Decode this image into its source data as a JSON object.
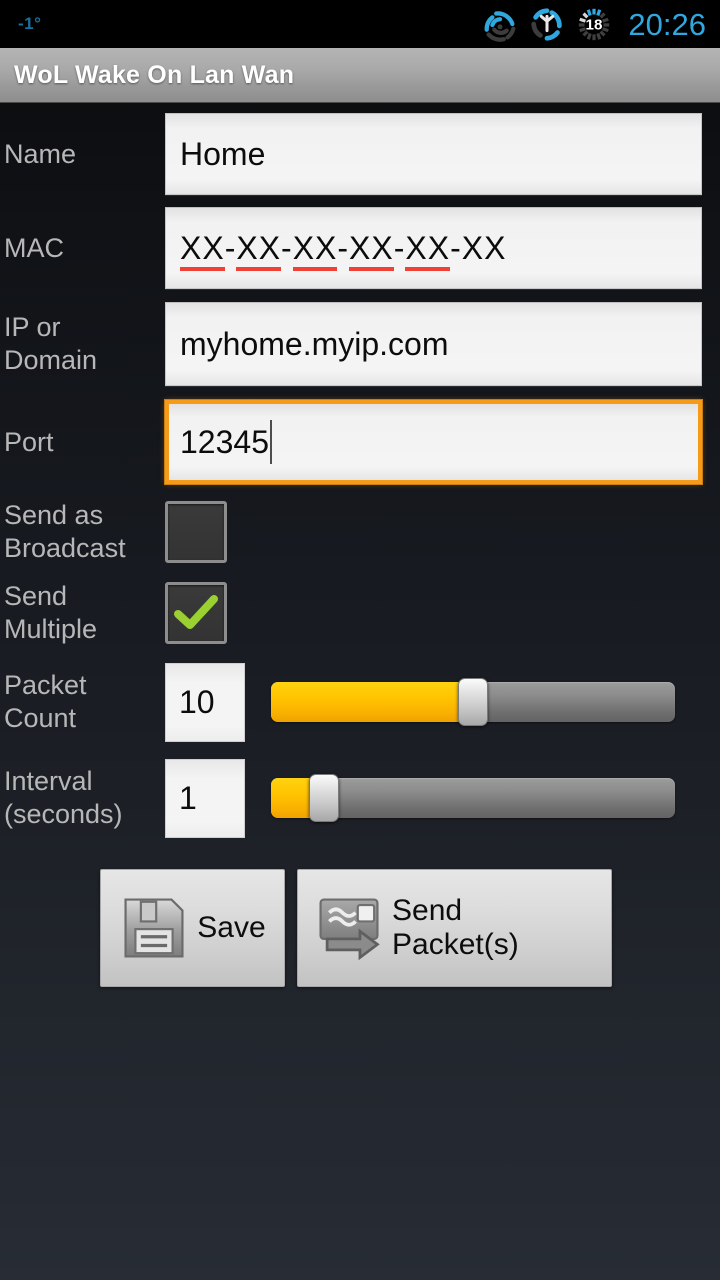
{
  "statusbar": {
    "temperature": "-1°",
    "clock": "20:26",
    "icons": [
      {
        "name": "signal-icon",
        "label": "signal"
      },
      {
        "name": "wifi-icon",
        "label": "wifi"
      },
      {
        "name": "battery-icon",
        "label": "battery",
        "value": "18"
      }
    ]
  },
  "titlebar": {
    "title": "WoL Wake On Lan Wan"
  },
  "form": {
    "name": {
      "label": "Name",
      "value": "Home",
      "placeholder": "Name"
    },
    "mac": {
      "label": "MAC",
      "value": "XX-XX-XX-XX-XX-XX",
      "placeholder": "XX-XX-XX-XX-XX-XX",
      "segments": [
        "XX",
        "XX",
        "XX",
        "XX",
        "XX",
        "XX"
      ],
      "separator": "-",
      "misspelled_segments": 5
    },
    "ip_or_domain": {
      "label": "IP or Domain",
      "value": "myhome.myip.com",
      "placeholder": "IP or Domain"
    },
    "port": {
      "label": "Port",
      "value": "12345",
      "placeholder": "Port",
      "focused": true
    },
    "send_as_broadcast": {
      "label": "Send as Broadcast",
      "checked": false
    },
    "send_multiple": {
      "label": "Send Multiple",
      "checked": true
    },
    "packet_count": {
      "label": "Packet Count",
      "value": "10",
      "slider_percent": 50
    },
    "interval": {
      "label": "Interval (seconds)",
      "value": "1",
      "slider_percent": 13
    }
  },
  "buttons": {
    "save": {
      "label": "Save",
      "icon": "floppy-disk-icon"
    },
    "send": {
      "label": "Send Packet(s)",
      "icon": "send-packet-icon"
    }
  },
  "colors": {
    "accent_orange": "#f59a19",
    "slider_yellow": "#ffc400",
    "check_green": "#9ad030",
    "clock_blue": "#2fa8e0",
    "temp_blue": "#1b6f9e",
    "spellcheck_red": "#ef4136"
  }
}
